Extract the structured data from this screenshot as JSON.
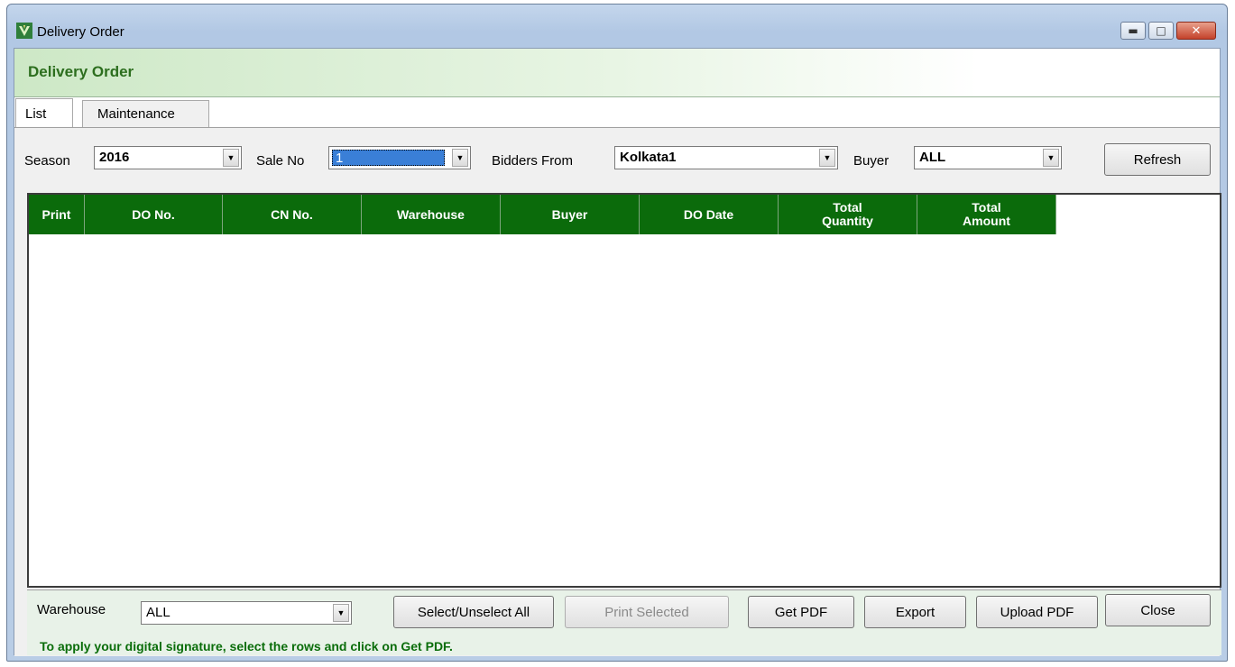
{
  "window": {
    "title": "Delivery Order"
  },
  "header": {
    "title": "Delivery Order"
  },
  "tabs": [
    {
      "label": "List"
    },
    {
      "label": "Maintenance"
    }
  ],
  "filters": {
    "season": {
      "label": "Season",
      "value": "2016"
    },
    "sale_no": {
      "label": "Sale No",
      "value": "1"
    },
    "bidders_from": {
      "label": "Bidders From",
      "value": "Kolkata1"
    },
    "buyer": {
      "label": "Buyer",
      "value": "ALL"
    },
    "refresh_label": "Refresh"
  },
  "grid": {
    "columns": [
      "Print",
      "DO No.",
      "CN No.",
      "Warehouse",
      "Buyer",
      "DO Date",
      "Total Quantity",
      "Total Amount"
    ],
    "rows": []
  },
  "footer": {
    "warehouse": {
      "label": "Warehouse",
      "value": "ALL"
    },
    "select_all_label": "Select/Unselect All",
    "print_selected_label": "Print Selected",
    "get_pdf_label": "Get PDF",
    "export_label": "Export",
    "upload_pdf_label": "Upload PDF",
    "close_label": "Close",
    "hint": "To apply your digital signature, select the rows and click on Get PDF."
  },
  "colors": {
    "grid_header": "#0b6b0b",
    "header_title": "#2c6e1e",
    "hint": "#0a6d0a"
  }
}
